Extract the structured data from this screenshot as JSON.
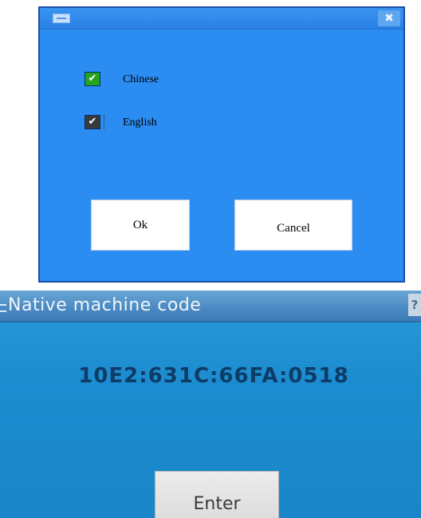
{
  "language_dialog": {
    "options": [
      {
        "label": "Chinese",
        "checked": true,
        "box_color": "#22a51f"
      },
      {
        "label": "English",
        "checked": true,
        "box_color": "#3a3a3a"
      }
    ],
    "check_glyph": "✔",
    "ok_label": "Ok",
    "cancel_label": "Cancel",
    "close_glyph": "✖",
    "colors": {
      "background": "#2b8cf2",
      "border": "#1a4fa8"
    }
  },
  "machine_code_panel": {
    "title": "Native machine code",
    "help_glyph": "?",
    "code": "10E2:631C:66FA:0518",
    "enter_label": "Enter",
    "colors": {
      "background": "#1c8cd0",
      "code_text": "#0d3c66"
    }
  }
}
